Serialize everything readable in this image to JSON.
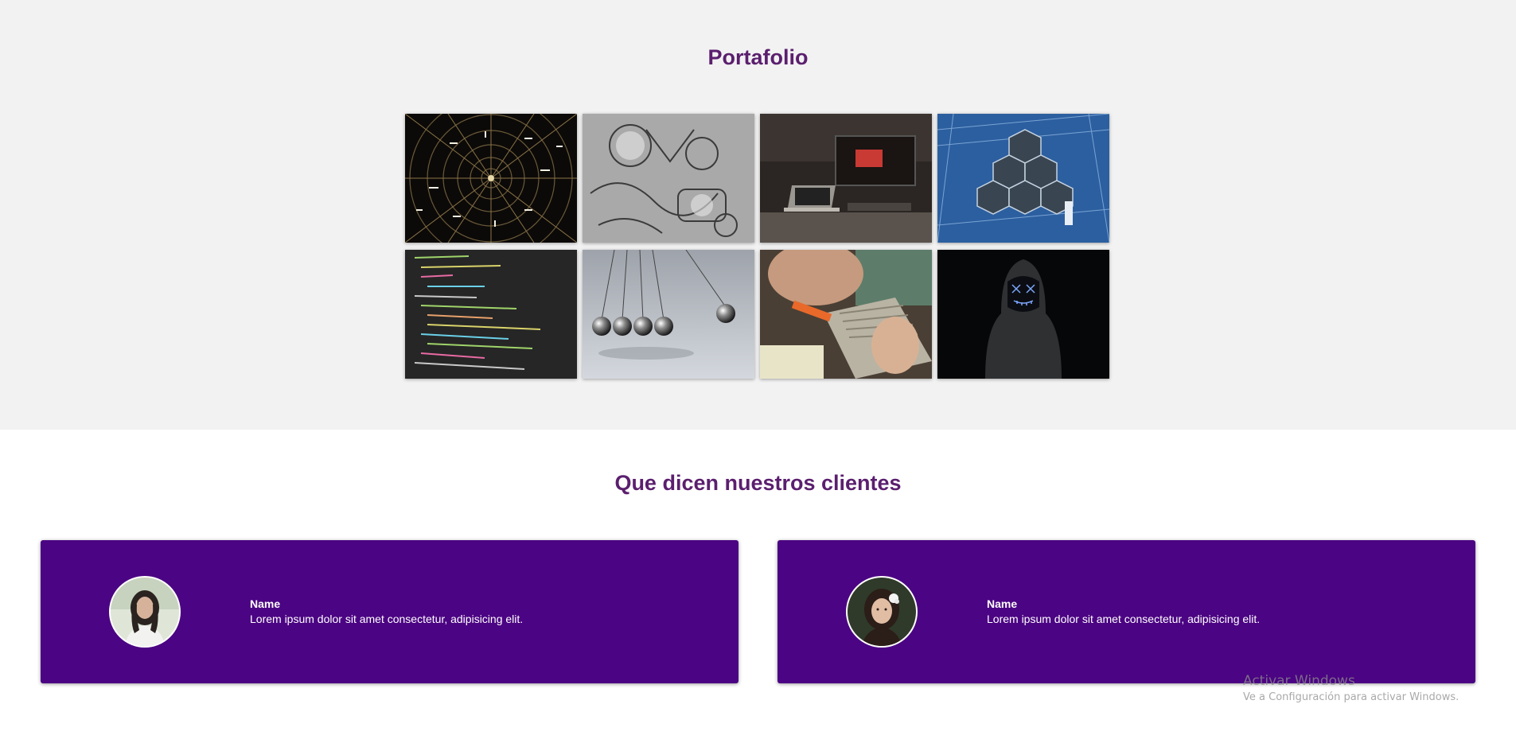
{
  "portfolio": {
    "title": "Portafolio",
    "images": [
      {
        "name": "tunnel-lights-image"
      },
      {
        "name": "doodle-art-image"
      },
      {
        "name": "workstation-laptop-image"
      },
      {
        "name": "telescope-mirrors-image"
      },
      {
        "name": "code-screen-image"
      },
      {
        "name": "newtons-cradle-image"
      },
      {
        "name": "hardware-repair-image"
      },
      {
        "name": "hooded-figure-image"
      }
    ]
  },
  "testimonials": {
    "title": "Que dicen nuestros clientes",
    "cards": [
      {
        "name": "Name",
        "quote": "Lorem ipsum dolor sit amet consectetur, adipisicing elit."
      },
      {
        "name": "Name",
        "quote": "Lorem ipsum dolor sit amet consectetur, adipisicing elit."
      }
    ]
  },
  "watermark": {
    "title": "Activar Windows",
    "subtitle": "Ve a Configuración para activar Windows."
  },
  "colors": {
    "accent": "#5b1f6e",
    "card_background": "#4b0483",
    "portfolio_background": "#f2f2f2"
  }
}
